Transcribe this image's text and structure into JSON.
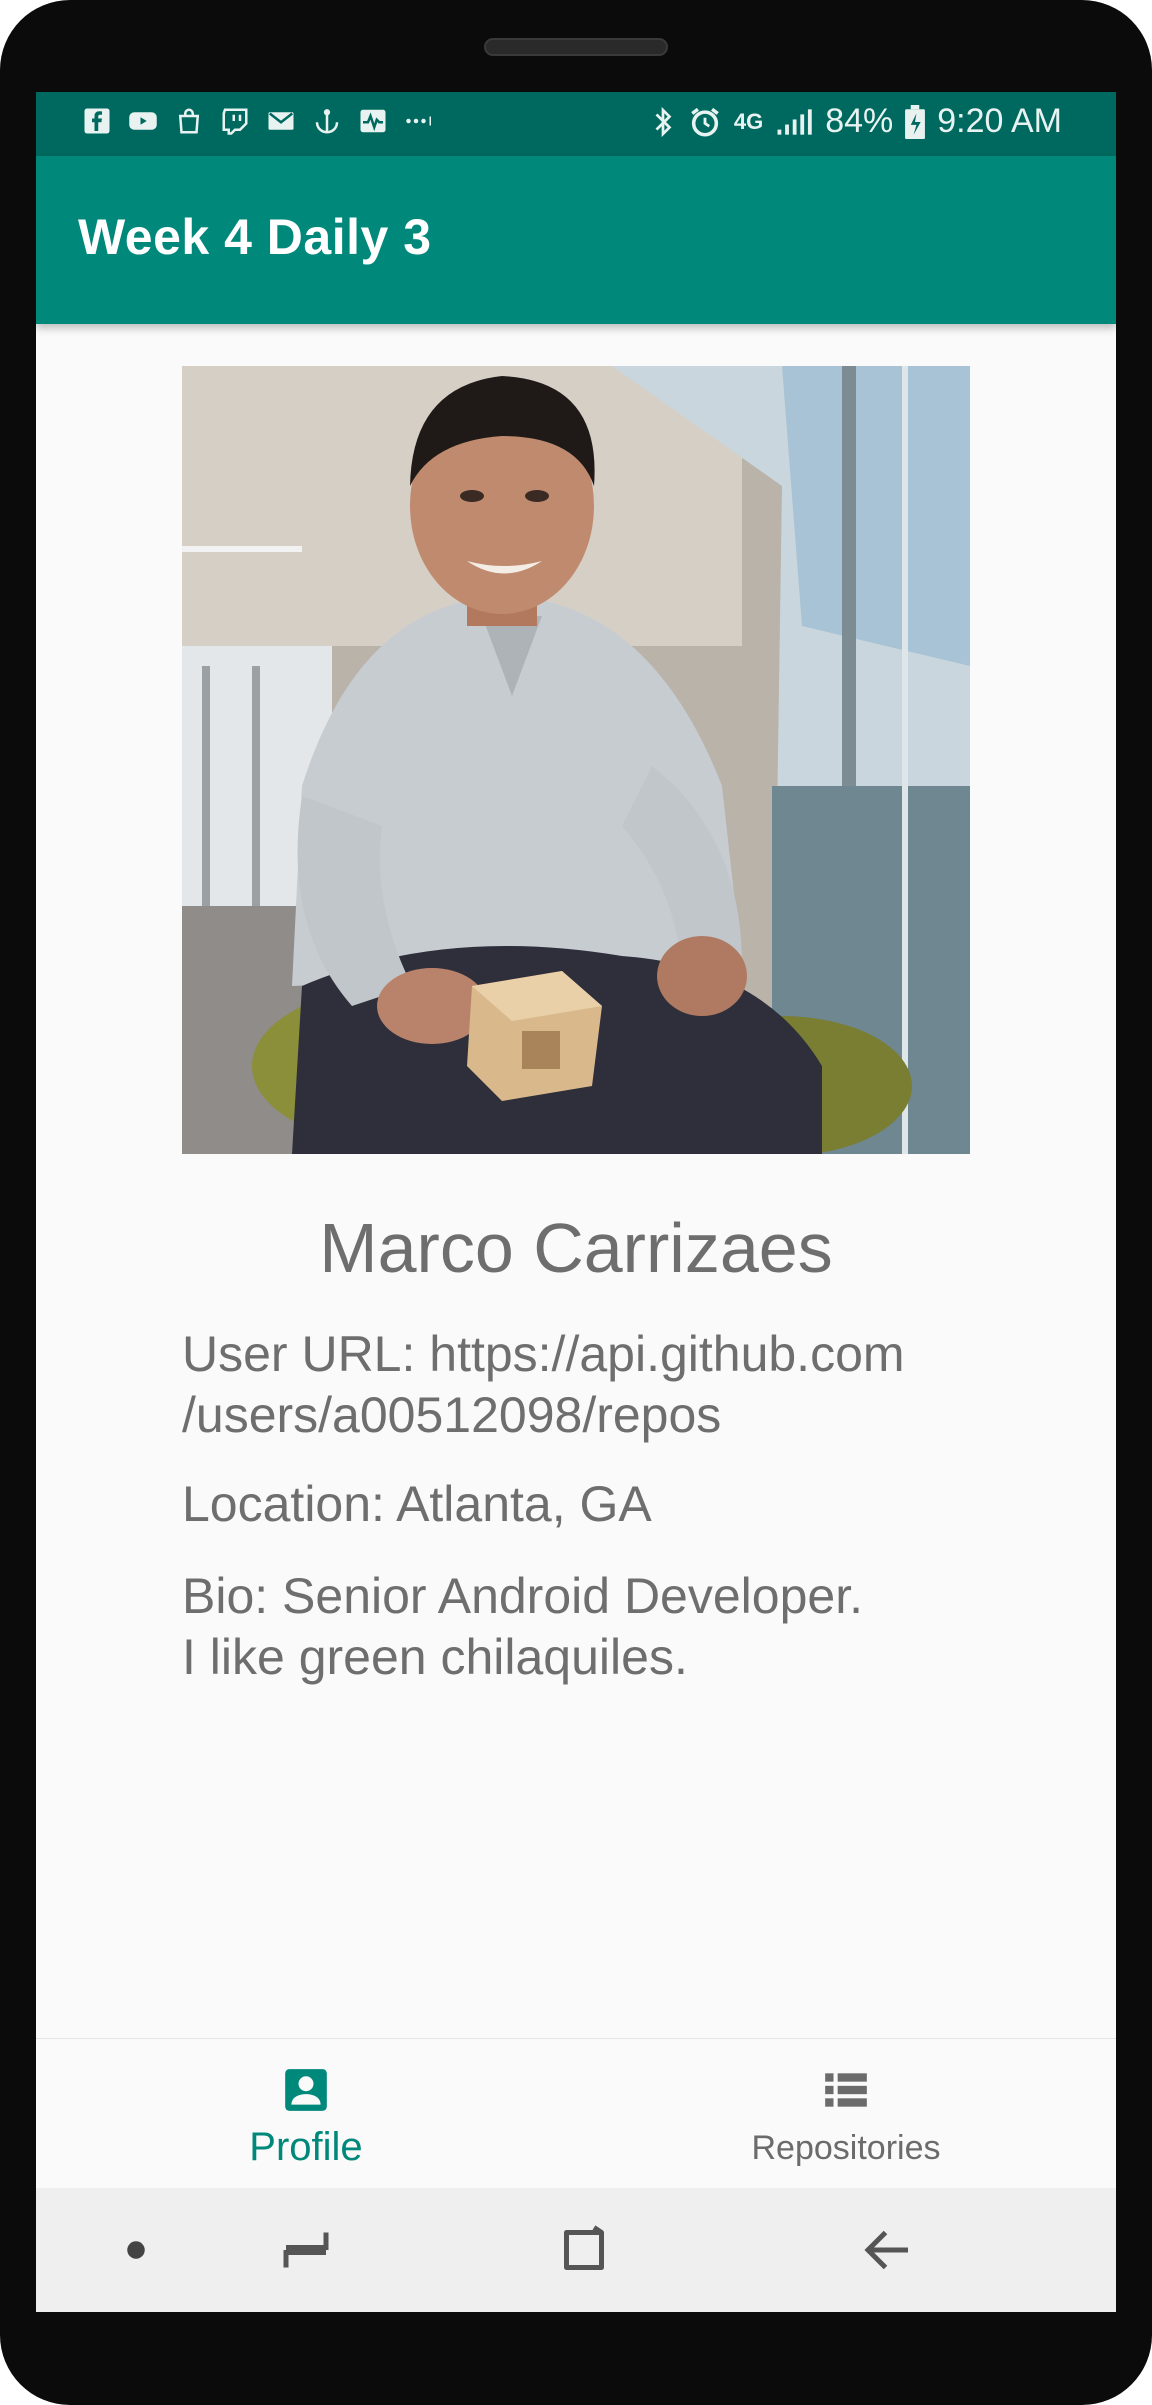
{
  "status_bar": {
    "left_icons": [
      "facebook-icon",
      "youtube-icon",
      "shopping-bag-icon",
      "twitch-icon",
      "gmail-icon",
      "anchor-icon",
      "activity-icon",
      "more-dots-icon"
    ],
    "battery": "84%",
    "time": "9:20 AM",
    "network": "4G"
  },
  "app_bar": {
    "title": "Week 4 Daily 3"
  },
  "profile": {
    "name": "Marco Carrizaes",
    "user_url": "User URL: https://api.github.com\n/users/a00512098/repos",
    "location": "Location: Atlanta, GA",
    "bio": "Bio: Senior Android Developer.\nI like green chilaquiles."
  },
  "bottom_nav": {
    "items": [
      {
        "label": "Profile",
        "icon": "account-box-icon",
        "selected": true
      },
      {
        "label": "Repositories",
        "icon": "view-list-icon",
        "selected": false
      }
    ]
  },
  "colors": {
    "primary": "#00897b",
    "primary_dark": "#00695f",
    "text": "#6e6e6e"
  }
}
